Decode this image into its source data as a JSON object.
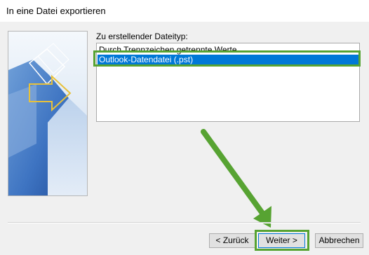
{
  "window": {
    "title": "In eine Datei exportieren"
  },
  "file_type_list": {
    "label": "Zu erstellender Dateityp:",
    "items": [
      {
        "label": "Durch Trennzeichen getrennte Werte",
        "selected": false
      },
      {
        "label": "Outlook-Datendatei (.pst)",
        "selected": true
      }
    ]
  },
  "buttons": {
    "back": "< Zurück",
    "next": "Weiter >",
    "cancel": "Abbrechen"
  },
  "colors": {
    "selection": "#0078d7",
    "annotation": "#57a332"
  }
}
